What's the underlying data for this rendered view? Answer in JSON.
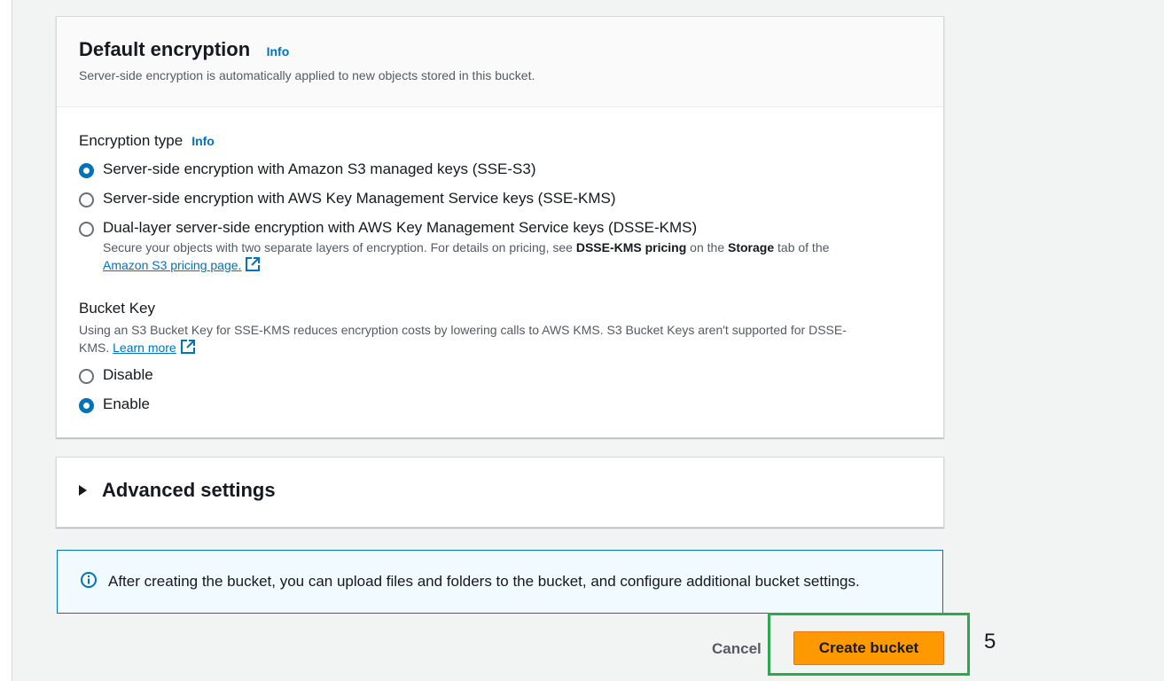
{
  "encryption_panel": {
    "title": "Default encryption",
    "info": "Info",
    "description": "Server-side encryption is automatically applied to new objects stored in this bucket.",
    "type_label": "Encryption type",
    "type_info": "Info",
    "options": [
      {
        "label": "Server-side encryption with Amazon S3 managed keys (SSE-S3)",
        "checked": true
      },
      {
        "label": "Server-side encryption with AWS Key Management Service keys (SSE-KMS)",
        "checked": false
      },
      {
        "label": "Dual-layer server-side encryption with AWS Key Management Service keys (DSSE-KMS)",
        "checked": false
      }
    ],
    "dsse_note_1": "Secure your objects with two separate layers of encryption. For details on pricing, see ",
    "dsse_note_bold_1": "DSSE-KMS pricing",
    "dsse_note_2": " on the ",
    "dsse_note_bold_2": "Storage",
    "dsse_note_3": " tab of the",
    "dsse_link": "Amazon S3 pricing page.",
    "bucket_key": {
      "label": "Bucket Key",
      "description_1": "Using an S3 Bucket Key for SSE-KMS reduces encryption costs by lowering calls to AWS KMS. S3 Bucket Keys aren't supported for DSSE-",
      "description_2": "KMS. ",
      "learn_more": "Learn more",
      "options": [
        {
          "label": "Disable",
          "checked": false
        },
        {
          "label": "Enable",
          "checked": true
        }
      ]
    }
  },
  "advanced": {
    "title": "Advanced settings"
  },
  "alert": {
    "icon": "info-circle-icon",
    "text": "After creating the bucket, you can upload files and folders to the bucket, and configure additional bucket settings."
  },
  "actions": {
    "cancel": "Cancel",
    "create": "Create bucket"
  },
  "step_marker": "5",
  "colors": {
    "accent": "#0073bb",
    "primary_button": "#ff9900",
    "highlight": "#2ea84d"
  }
}
